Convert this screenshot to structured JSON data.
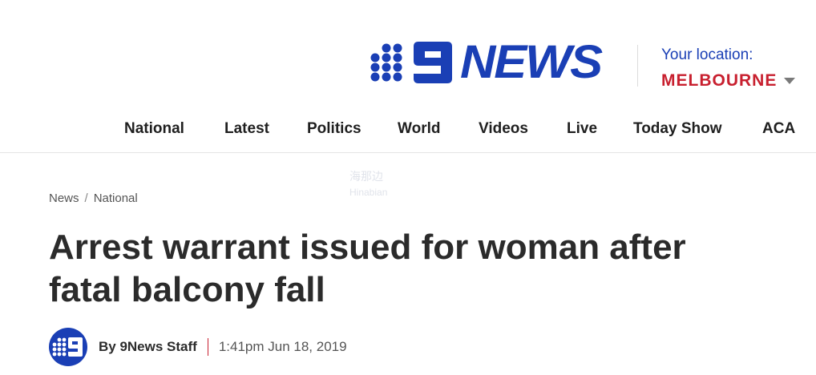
{
  "header": {
    "logo_text": "NEWS",
    "location_label": "Your location:",
    "location_city": "MELBOURNE",
    "brand_blue": "#1a3fb5",
    "brand_red": "#c8202f"
  },
  "nav": {
    "items": [
      {
        "label": "National"
      },
      {
        "label": "Latest"
      },
      {
        "label": "Politics"
      },
      {
        "label": "World"
      },
      {
        "label": "Videos"
      },
      {
        "label": "Live"
      },
      {
        "label": "Today Show"
      },
      {
        "label": "ACA"
      }
    ]
  },
  "watermark": {
    "line1": "海那边",
    "line2": "Hinabian"
  },
  "breadcrumb": {
    "root": "News",
    "separator": "/",
    "section": "National"
  },
  "article": {
    "headline_line1": "Arrest warrant issued for woman after",
    "headline_line2": "fatal balcony fall",
    "author": "By 9News Staff",
    "timestamp": "1:41pm Jun 18, 2019",
    "avatar_icon": "9news-logo-icon"
  },
  "icons": {
    "logo_dots": "nine-dots-icon",
    "location_caret": "caret-down-icon"
  }
}
